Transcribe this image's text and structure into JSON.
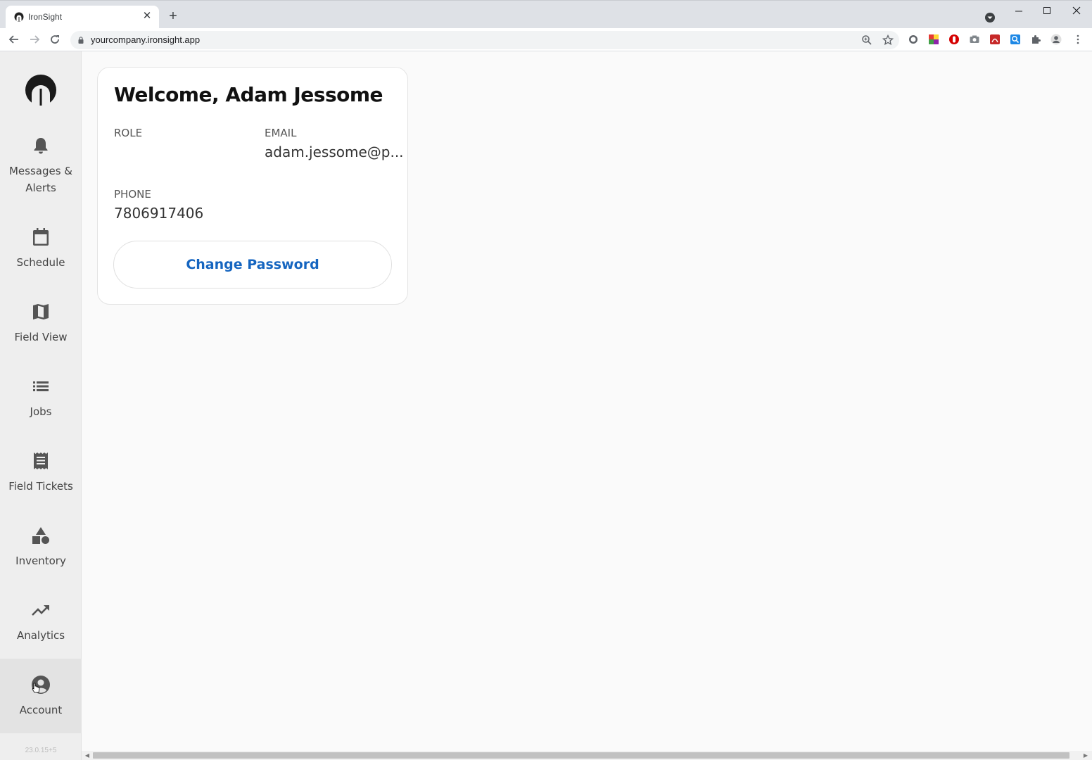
{
  "browser": {
    "tab_title": "IronSight",
    "url": "yourcompany.ironsight.app",
    "new_tab_glyph": "+",
    "close_glyph": "✕"
  },
  "sidebar": {
    "items": [
      {
        "label_line1": "Messages &",
        "label_line2": "Alerts",
        "icon": "bell-icon"
      },
      {
        "label": "Schedule",
        "icon": "calendar-icon"
      },
      {
        "label": "Field View",
        "icon": "map-icon"
      },
      {
        "label": "Jobs",
        "icon": "list-icon"
      },
      {
        "label": "Field Tickets",
        "icon": "receipt-icon"
      },
      {
        "label": "Inventory",
        "icon": "shapes-icon"
      },
      {
        "label": "Analytics",
        "icon": "trending-up-icon"
      },
      {
        "label": "Account",
        "icon": "account-circle-icon",
        "active": true
      }
    ],
    "version": "23.0.15+5"
  },
  "account": {
    "welcome": "Welcome, Adam Jessome",
    "role_label": "ROLE",
    "role_value": "",
    "email_label": "EMAIL",
    "email_value": "adam.jessome@p...",
    "phone_label": "PHONE",
    "phone_value": "7806917406",
    "change_password_label": "Change Password"
  },
  "colors": {
    "accent": "#1565c0",
    "sidebar_bg": "#eeeeee",
    "page_bg": "#fafafa"
  }
}
